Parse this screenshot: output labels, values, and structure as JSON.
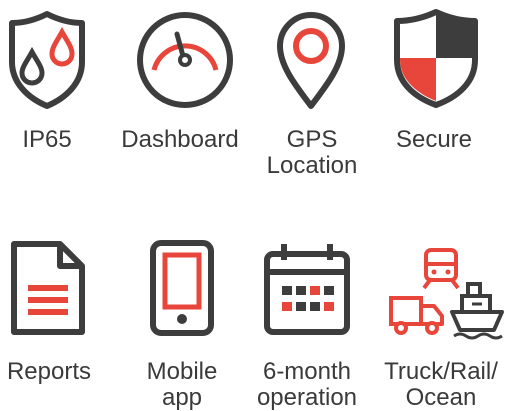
{
  "colors": {
    "dark": "#3d3d3d",
    "accent": "#e9463b"
  },
  "features": [
    {
      "label": "IP65",
      "icon": "water-drops-shield-icon"
    },
    {
      "label": "Dashboard",
      "icon": "speedometer-icon"
    },
    {
      "label": "GPS\nLocation",
      "icon": "map-pin-icon"
    },
    {
      "label": "Secure",
      "icon": "security-shield-icon"
    },
    {
      "label": "Reports",
      "icon": "document-icon"
    },
    {
      "label": "Mobile\napp",
      "icon": "smartphone-icon"
    },
    {
      "label": "6-month\noperation",
      "icon": "calendar-icon"
    },
    {
      "label": "Truck/Rail/\nOcean",
      "icon": "transport-modes-icon"
    }
  ]
}
